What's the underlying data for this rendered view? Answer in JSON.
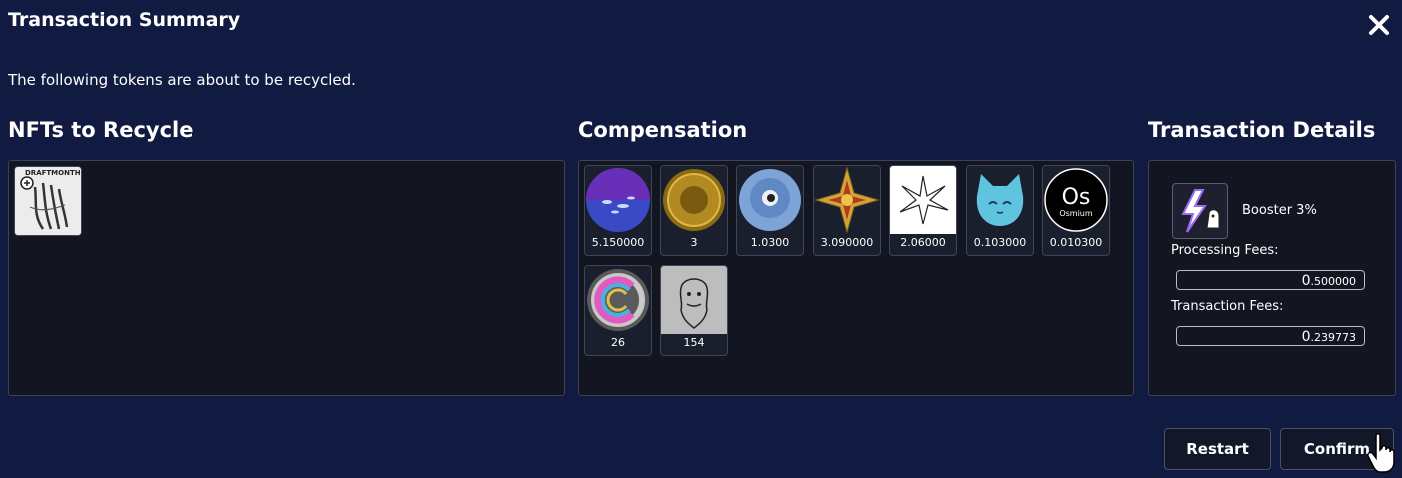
{
  "modal": {
    "title": "Transaction Summary",
    "subtitle": "The following tokens are about to be recycled."
  },
  "sections": {
    "nfts_title": "NFTs to Recycle",
    "compensation_title": "Compensation",
    "details_title": "Transaction Details"
  },
  "nfts": [
    {
      "name": "nft-drawing-hands",
      "banner": "DRAFTMONTHLY"
    }
  ],
  "compensation": [
    {
      "icon": "purple-planet-token-icon",
      "amount": "5.150000"
    },
    {
      "icon": "gold-coin-token-icon",
      "amount": "3"
    },
    {
      "icon": "blue-eye-token-icon",
      "amount": "1.0300"
    },
    {
      "icon": "golden-star-token-icon",
      "amount": "3.090000"
    },
    {
      "icon": "black-star-token-icon",
      "amount": "2.06000"
    },
    {
      "icon": "blue-cat-token-icon",
      "amount": "0.103000"
    },
    {
      "icon": "osmium-token-icon",
      "amount": "0.010300",
      "symbol": "Os",
      "label": "Osmium"
    },
    {
      "icon": "rainbow-coin-token-icon",
      "amount": "26"
    },
    {
      "icon": "bearded-sketch-token-icon",
      "amount": "154"
    }
  ],
  "details": {
    "booster_icon": "lightning-booster-icon",
    "booster_label": "Booster 3%",
    "processing_label": "Processing Fees:",
    "processing_int": "0",
    "processing_dec": ".500000",
    "transaction_label": "Transaction Fees:",
    "transaction_int": "0",
    "transaction_dec": ".239773"
  },
  "buttons": {
    "restart": "Restart",
    "confirm": "Confirm"
  },
  "colors": {
    "background": "#111a40",
    "panel": "#131520",
    "border": "#3b4157"
  }
}
